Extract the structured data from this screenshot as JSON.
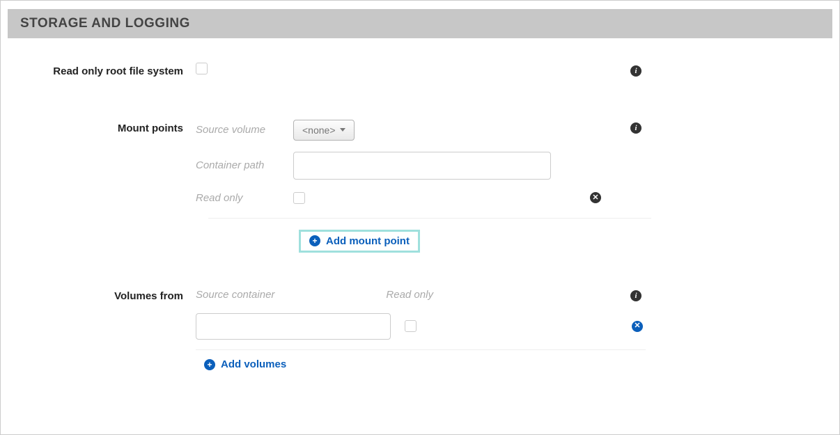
{
  "section": {
    "title": "STORAGE AND LOGGING"
  },
  "readOnlyRoot": {
    "label": "Read only root file system"
  },
  "mountPoints": {
    "label": "Mount points",
    "sourceVolumeLabel": "Source volume",
    "sourceVolumeValue": "<none>",
    "containerPathLabel": "Container path",
    "containerPathValue": "",
    "readOnlyLabel": "Read only",
    "addLabel": "Add mount point"
  },
  "volumesFrom": {
    "label": "Volumes from",
    "sourceContainerLabel": "Source container",
    "sourceContainerValue": "",
    "readOnlyLabel": "Read only",
    "addLabel": "Add volumes"
  },
  "icons": {
    "info": "i",
    "close": "✕",
    "plus": "+"
  }
}
